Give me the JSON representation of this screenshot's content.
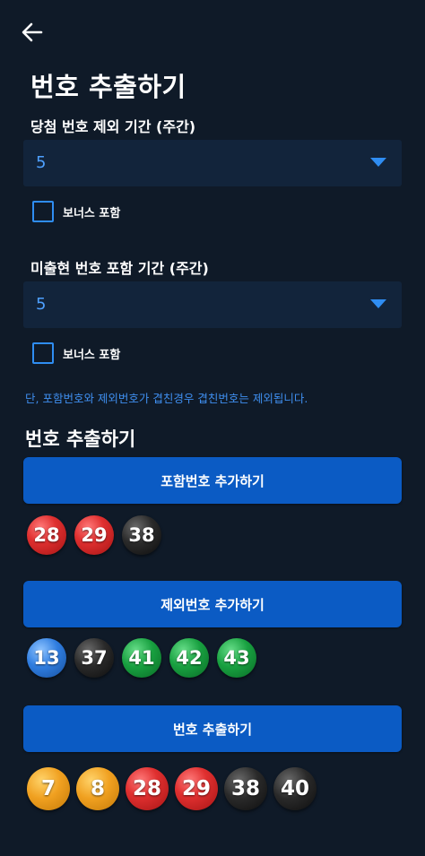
{
  "header": {
    "back_icon": "arrow-left-icon",
    "title": "번호 추출하기"
  },
  "win_exclusion": {
    "label": "당첨 번호 제외 기간 (주간)",
    "selected": "5",
    "bonus_label": "보너스 포함",
    "bonus_checked": false
  },
  "unreleased_inclusion": {
    "label": "미출현 번호 포함 기간 (주간)",
    "selected": "5",
    "bonus_label": "보너스 포함",
    "bonus_checked": false
  },
  "notice": "단, 포함번호와 제외번호가 겹친경우 겹친번호는 제외됩니다.",
  "section_title": "번호 추출하기",
  "include_button": "포함번호 추가하기",
  "include_numbers": [
    {
      "n": "28",
      "color": "red"
    },
    {
      "n": "29",
      "color": "red"
    },
    {
      "n": "38",
      "color": "black"
    }
  ],
  "exclude_button": "제외번호 추가하기",
  "exclude_numbers": [
    {
      "n": "13",
      "color": "blue"
    },
    {
      "n": "37",
      "color": "black"
    },
    {
      "n": "41",
      "color": "green"
    },
    {
      "n": "42",
      "color": "green"
    },
    {
      "n": "43",
      "color": "green"
    }
  ],
  "extract_button": "번호 추출하기",
  "result_numbers": [
    {
      "n": "7",
      "color": "yellow"
    },
    {
      "n": "8",
      "color": "yellow"
    },
    {
      "n": "28",
      "color": "red"
    },
    {
      "n": "29",
      "color": "red"
    },
    {
      "n": "38",
      "color": "black"
    },
    {
      "n": "40",
      "color": "black"
    }
  ],
  "colors": {
    "background": "#0f1a28",
    "accent": "#2f8df2",
    "button": "#0b5bc4",
    "select_bg": "#12243b"
  }
}
